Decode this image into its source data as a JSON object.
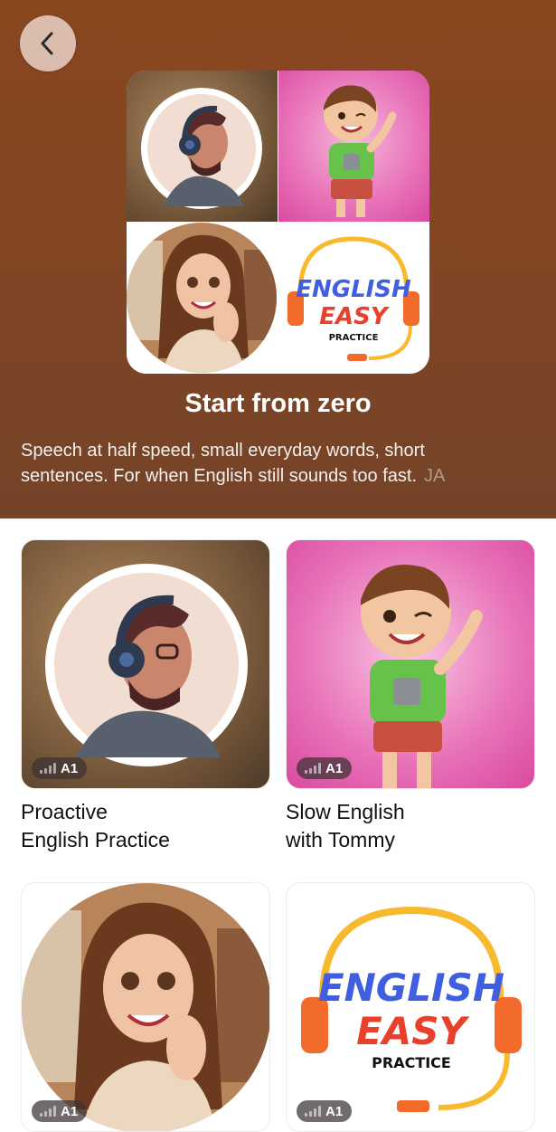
{
  "header": {
    "back_icon": "chevron-left-icon"
  },
  "hero": {
    "title": "Start from zero",
    "description": "Speech at half speed, small everyday words, short sentences. For when English still sounds too fast.",
    "description_suffix": "JA",
    "collage": [
      "headphones-man-avatar",
      "waving-boy-avatar",
      "smiling-woman-avatar",
      "english-easy-practice-logo"
    ]
  },
  "cards": [
    {
      "title": "Proactive\nEnglish Practice",
      "level": "A1",
      "image": "headphones-man-avatar"
    },
    {
      "title": "Slow English\nwith Tommy",
      "level": "A1",
      "image": "waving-boy-avatar"
    },
    {
      "title": "",
      "level": "A1",
      "image": "smiling-woman-avatar"
    },
    {
      "title": "",
      "level": "A1",
      "image": "english-easy-practice-logo"
    }
  ],
  "logo_text": {
    "line1": "ENGLISH",
    "line2": "EASY",
    "line3": "PRACTICE"
  },
  "colors": {
    "hero_bg": "#8a4720",
    "logo_blue": "#3f5fe0",
    "logo_red": "#e8402a",
    "headset_orange": "#f26b2a",
    "headset_yellow": "#f7b92e",
    "pink_bg": "#e871b8"
  }
}
